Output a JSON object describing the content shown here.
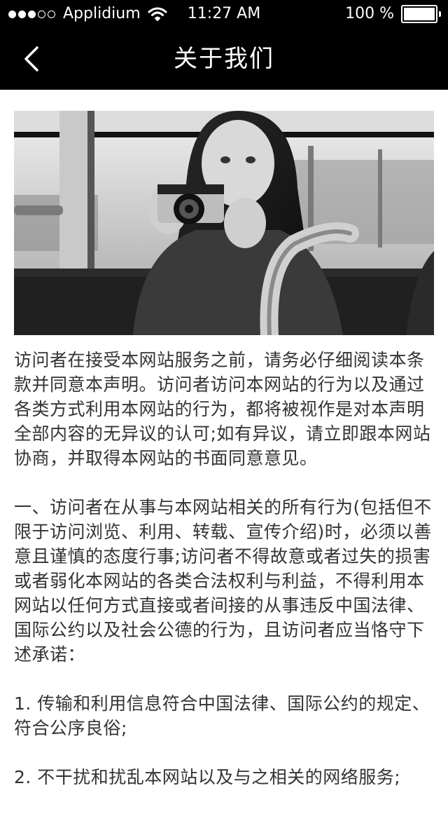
{
  "status_bar": {
    "carrier": "Applidium",
    "time": "11:27 AM",
    "battery": "100 %",
    "signal_filled": 3,
    "signal_empty": 2,
    "battery_level": 1.0
  },
  "nav": {
    "title": "关于我们",
    "back_icon": "chevron-left-icon"
  },
  "hero": {
    "alt": "woman holding a camera on a tram, black and white photo"
  },
  "article": {
    "paragraphs": [
      "访问者在接受本网站服务之前，请务必仔细阅读本条款并同意本声明。访问者访问本网站的行为以及通过各类方式利用本网站的行为，都将被视作是对本声明全部内容的无异议的认可;如有异议，请立即跟本网站协商，并取得本网站的书面同意意见。",
      "一、访问者在从事与本网站相关的所有行为(包括但不限于访问浏览、利用、转载、宣传介绍)时，必须以善意且谨慎的态度行事;访问者不得故意或者过失的损害或者弱化本网站的各类合法权利与利益，不得利用本网站以任何方式直接或者间接的从事违反中国法律、国际公约以及社会公德的行为，且访问者应当恪守下述承诺：",
      "1. 传输和利用信息符合中国法律、国际公约的规定、符合公序良俗;",
      "2. 不干扰和扰乱本网站以及与之相关的网络服务;"
    ]
  },
  "colors": {
    "header_bg": "#000000",
    "header_text": "#ffffff",
    "body_text": "#333333",
    "page_bg": "#ffffff"
  }
}
